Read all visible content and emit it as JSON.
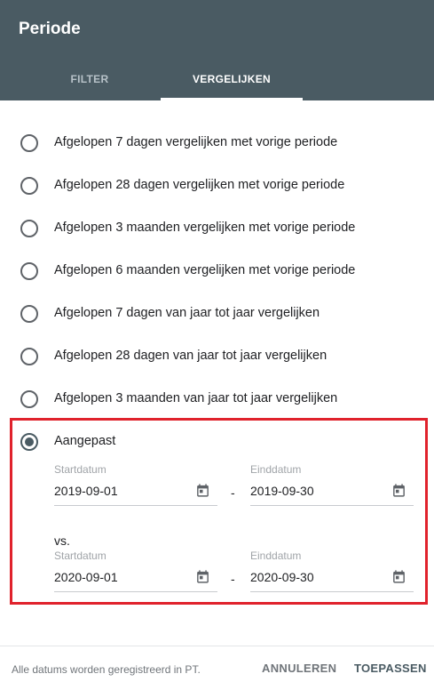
{
  "dialog": {
    "title": "Periode"
  },
  "tabs": [
    {
      "label": "FILTER",
      "active": false
    },
    {
      "label": "VERGELIJKEN",
      "active": true
    }
  ],
  "options": [
    {
      "label": "Afgelopen 7 dagen vergelijken met vorige periode",
      "selected": false
    },
    {
      "label": "Afgelopen 28 dagen vergelijken met vorige periode",
      "selected": false
    },
    {
      "label": "Afgelopen 3 maanden vergelijken met vorige periode",
      "selected": false
    },
    {
      "label": "Afgelopen 6 maanden vergelijken met vorige periode",
      "selected": false
    },
    {
      "label": "Afgelopen 7 dagen van jaar tot jaar vergelijken",
      "selected": false
    },
    {
      "label": "Afgelopen 28 dagen van jaar tot jaar vergelijken",
      "selected": false
    },
    {
      "label": "Afgelopen 3 maanden van jaar tot jaar vergelijken",
      "selected": false
    },
    {
      "label": "Aangepast",
      "selected": true
    }
  ],
  "custom": {
    "range1": {
      "start_label": "Startdatum",
      "start_value": "2019-09-01",
      "end_label": "Einddatum",
      "end_value": "2019-09-30"
    },
    "separator": "-",
    "vs_label": "vs.",
    "range2": {
      "start_label": "Startdatum",
      "start_value": "2020-09-01",
      "end_label": "Einddatum",
      "end_value": "2020-09-30"
    }
  },
  "footer": {
    "note": "Alle datums worden geregistreerd in PT.",
    "cancel_label": "ANNULEREN",
    "apply_label": "TOEPASSEN"
  },
  "colors": {
    "header": "#4a5b63",
    "highlight": "#e0222c"
  }
}
